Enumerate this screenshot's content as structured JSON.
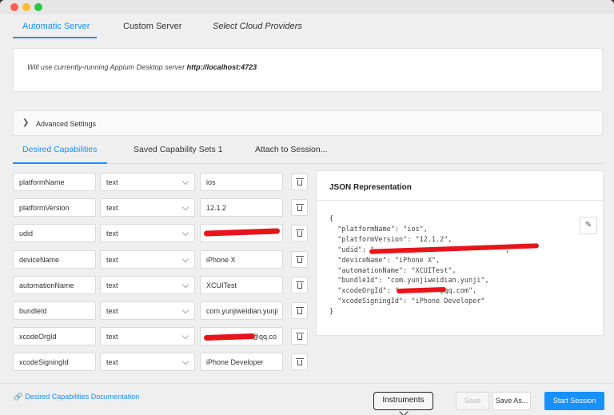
{
  "window": {
    "controls": [
      "close",
      "minimize",
      "zoom"
    ]
  },
  "top_tabs": [
    {
      "label": "Automatic Server",
      "active": true
    },
    {
      "label": "Custom Server",
      "active": false
    },
    {
      "label": "Select Cloud Providers",
      "active": false
    }
  ],
  "server": {
    "text": "Will use currently-running Appium Desktop server ",
    "url": "http://localhost:4723"
  },
  "advanced": {
    "label": "Advanced Settings",
    "expanded": false
  },
  "cap_tabs": [
    {
      "label": "Desired Capabilities",
      "active": true
    },
    {
      "label": "Saved Capability Sets 1",
      "active": false
    },
    {
      "label": "Attach to Session...",
      "active": false
    }
  ],
  "capabilities": [
    {
      "name": "platformName",
      "type": "text",
      "value": "ios",
      "redacted": false
    },
    {
      "name": "platformVersion",
      "type": "text",
      "value": "12.1.2",
      "redacted": false
    },
    {
      "name": "udid",
      "type": "text",
      "value": "",
      "redacted": true
    },
    {
      "name": "deviceName",
      "type": "text",
      "value": "iPhone X",
      "redacted": false
    },
    {
      "name": "automationName",
      "type": "text",
      "value": "XCUITest",
      "redacted": false
    },
    {
      "name": "bundleId",
      "type": "text",
      "value": "com.yunjiweidian.yunji",
      "redacted": false
    },
    {
      "name": "xcodeOrgId",
      "type": "text",
      "value": "@qq.co",
      "redacted": true
    },
    {
      "name": "xcodeSigningId",
      "type": "text",
      "value": "iPhone Developer",
      "redacted": false
    }
  ],
  "json_panel": {
    "title": "JSON Representation",
    "lines": [
      "{",
      "  \"platformName\": \"ios\",",
      "  \"platformVersion\": \"12.1.2\",",
      "  \"udid\": \"                               \",",
      "  \"deviceName\": \"iPhone X\",",
      "  \"automationName\": \"XCUITest\",",
      "  \"bundleId\": \"com.yunjiweidian.yunji\",",
      "  \"xcodeOrgId\": \"          @qq.com\",",
      "  \"xcodeSigningId\": \"iPhone Developer\"",
      "}"
    ]
  },
  "footer": {
    "doc_link": "Desired Capabilities Documentation",
    "tooltip": "Instruments",
    "save": "Save",
    "save_as": "Save As...",
    "start": "Start Session"
  }
}
